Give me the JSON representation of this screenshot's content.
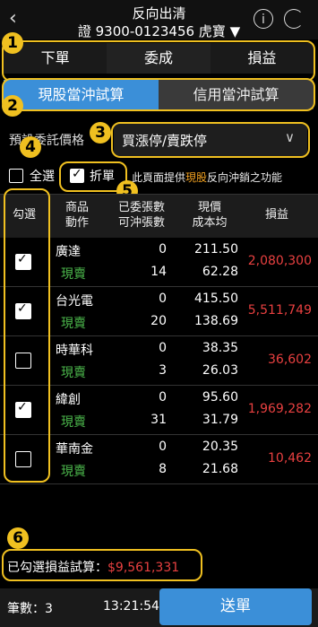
{
  "header": {
    "title": "反向出清",
    "account": "證 9300-0123456 虎寶 ▼",
    "back_icon": "chevron-left-icon",
    "info_icon": "info-icon",
    "refresh_icon": "refresh-icon"
  },
  "tabs": [
    "下單",
    "委成",
    "損益"
  ],
  "subtabs": [
    "現股當沖試算",
    "信用當沖試算"
  ],
  "price_type": {
    "label": "預設委託價格",
    "value": "買漲停/賣跌停"
  },
  "options": {
    "select_all": "全選",
    "split": "折單",
    "notice_pre": "此頁面提供",
    "notice_hl": "現股",
    "notice_post": "反向沖銷之功能"
  },
  "table": {
    "headers": {
      "select": "勾選",
      "product": "商品",
      "action": "動作",
      "ordered": "已委張數",
      "offsettable": "可沖張數",
      "price": "現價",
      "cost": "成本均",
      "pl": "損益"
    },
    "rows": [
      {
        "name": "廣達",
        "action": "現賣",
        "ordered": "0",
        "offset": "14",
        "price": "211.50",
        "cost": "62.28",
        "pl": "2,080,300",
        "checked": true
      },
      {
        "name": "台光電",
        "action": "現賣",
        "ordered": "0",
        "offset": "20",
        "price": "415.50",
        "cost": "138.69",
        "pl": "5,511,749",
        "checked": true
      },
      {
        "name": "時華科",
        "action": "現賣",
        "ordered": "0",
        "offset": "3",
        "price": "38.35",
        "cost": "26.03",
        "pl": "36,602",
        "checked": false
      },
      {
        "name": "緯創",
        "action": "現賣",
        "ordered": "0",
        "offset": "31",
        "price": "95.60",
        "cost": "31.79",
        "pl": "1,969,282",
        "checked": true
      },
      {
        "name": "華南金",
        "action": "現賣",
        "ordered": "0",
        "offset": "8",
        "price": "20.35",
        "cost": "21.68",
        "pl": "10,462",
        "checked": false
      }
    ]
  },
  "summary": {
    "label": "已勾選損益試算：",
    "value": "$9,561,331"
  },
  "footer": {
    "count_label": "筆數：",
    "count": "3",
    "time": "13:21:54",
    "send": "送單"
  },
  "badges": [
    "1",
    "2",
    "3",
    "4",
    "5",
    "6"
  ],
  "colors": {
    "accent": "#3b8fd8",
    "highlight": "#f0c020",
    "loss_profit": "#e84040",
    "action": "#4cb84c"
  }
}
